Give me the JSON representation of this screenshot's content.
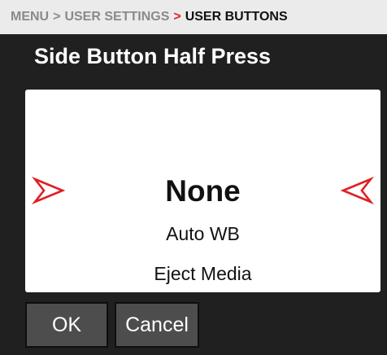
{
  "breadcrumb": {
    "items": [
      "MENU",
      "USER SETTINGS",
      "USER BUTTONS"
    ],
    "separator": ">"
  },
  "title": "Side Button Half Press",
  "picker": {
    "selected": "None",
    "options_below": [
      "Auto WB",
      "Eject Media"
    ],
    "arrow_left_icon": "right-pointing-arrow-icon",
    "arrow_right_icon": "left-pointing-arrow-icon"
  },
  "buttons": {
    "ok_label": "OK",
    "cancel_label": "Cancel"
  },
  "colors": {
    "accent": "#e01e24",
    "background": "#202020",
    "breadcrumb_bg": "#ebebeb",
    "button_bg": "#4d4d4d"
  }
}
